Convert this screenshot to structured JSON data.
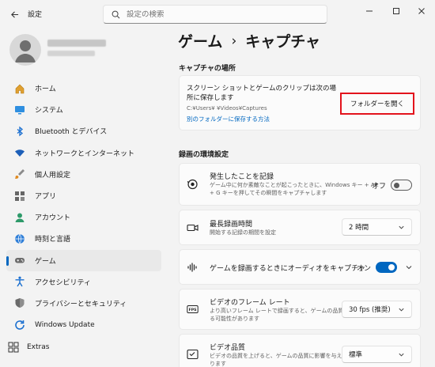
{
  "window": {
    "app_title": "設定",
    "search_placeholder": "設定の検索"
  },
  "sidebar": {
    "items": [
      {
        "label": "ホーム",
        "icon": "home-icon"
      },
      {
        "label": "システム",
        "icon": "system-icon"
      },
      {
        "label": "Bluetooth とデバイス",
        "icon": "bluetooth-icon"
      },
      {
        "label": "ネットワークとインターネット",
        "icon": "network-icon"
      },
      {
        "label": "個人用設定",
        "icon": "brush-icon"
      },
      {
        "label": "アプリ",
        "icon": "apps-icon"
      },
      {
        "label": "アカウント",
        "icon": "account-icon"
      },
      {
        "label": "時刻と言語",
        "icon": "globe-clock-icon"
      },
      {
        "label": "ゲーム",
        "icon": "gamepad-icon",
        "active": true
      },
      {
        "label": "アクセシビリティ",
        "icon": "accessibility-icon"
      },
      {
        "label": "プライバシーとセキュリティ",
        "icon": "shield-icon"
      },
      {
        "label": "Windows Update",
        "icon": "update-icon"
      }
    ],
    "extras_label": "Extras"
  },
  "main": {
    "breadcrumb_parent": "ゲーム",
    "breadcrumb_sep": "›",
    "breadcrumb_current": "キャプチャ",
    "location_section": "キャプチャの場所",
    "location_desc": "スクリーン ショットとゲームのクリップは次の場所に保存します",
    "location_path": "C:¥Users¥        ¥Videos¥Captures",
    "location_link": "別のフォルダーに保存する方法",
    "open_folder_label": "フォルダーを開く",
    "recording_section": "録画の環境設定",
    "rows": [
      {
        "title": "発生したことを記録",
        "subtitle": "ゲーム中に何か素敵なことが起こったときに、Windows キー + Alt + G キーを押してその瞬間をキャプチャします",
        "toggle_label": "オフ",
        "toggle_on": false
      },
      {
        "title": "最長録画時間",
        "subtitle": "開始する記録の期間を設定",
        "dropdown": "2 時間"
      },
      {
        "title": "ゲームを録画するときにオーディオをキャプチャ",
        "toggle_label": "オン",
        "toggle_on": true
      },
      {
        "title": "ビデオのフレーム レート",
        "subtitle": "より高いフレーム レートで録画すると、ゲームの品質に影響を与える可能性があります",
        "dropdown": "30 fps (推奨)"
      },
      {
        "title": "ビデオ品質",
        "subtitle": "ビデオの品質を上げると、ゲームの品質に影響を与える可能性があります",
        "dropdown": "標準"
      }
    ]
  },
  "colors": {
    "accent": "#0067c0",
    "highlight": "#e3131c",
    "background": "#f3f3f3",
    "card": "#fbfbfb"
  }
}
